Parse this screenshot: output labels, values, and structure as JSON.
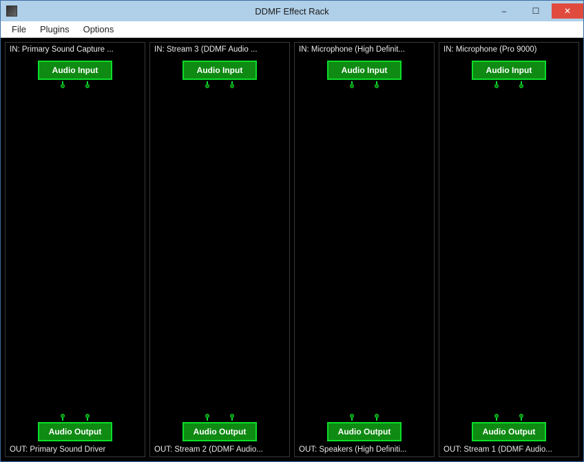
{
  "window": {
    "title": "DDMF Effect Rack",
    "minimize_glyph": "–",
    "maximize_glyph": "☐",
    "close_glyph": "✕"
  },
  "menu": {
    "file": "File",
    "plugins": "Plugins",
    "options": "Options"
  },
  "nodes": {
    "input_label": "Audio Input",
    "output_label": "Audio Output"
  },
  "channels": [
    {
      "in_label": "IN: Primary Sound Capture ...",
      "out_label": "OUT: Primary Sound Driver"
    },
    {
      "in_label": "IN: Stream 3 (DDMF Audio ...",
      "out_label": "OUT: Stream 2 (DDMF Audio..."
    },
    {
      "in_label": "IN: Microphone (High Definit...",
      "out_label": "OUT: Speakers (High Definiti..."
    },
    {
      "in_label": "IN: Microphone (Pro 9000)",
      "out_label": "OUT: Stream 1 (DDMF Audio..."
    }
  ]
}
